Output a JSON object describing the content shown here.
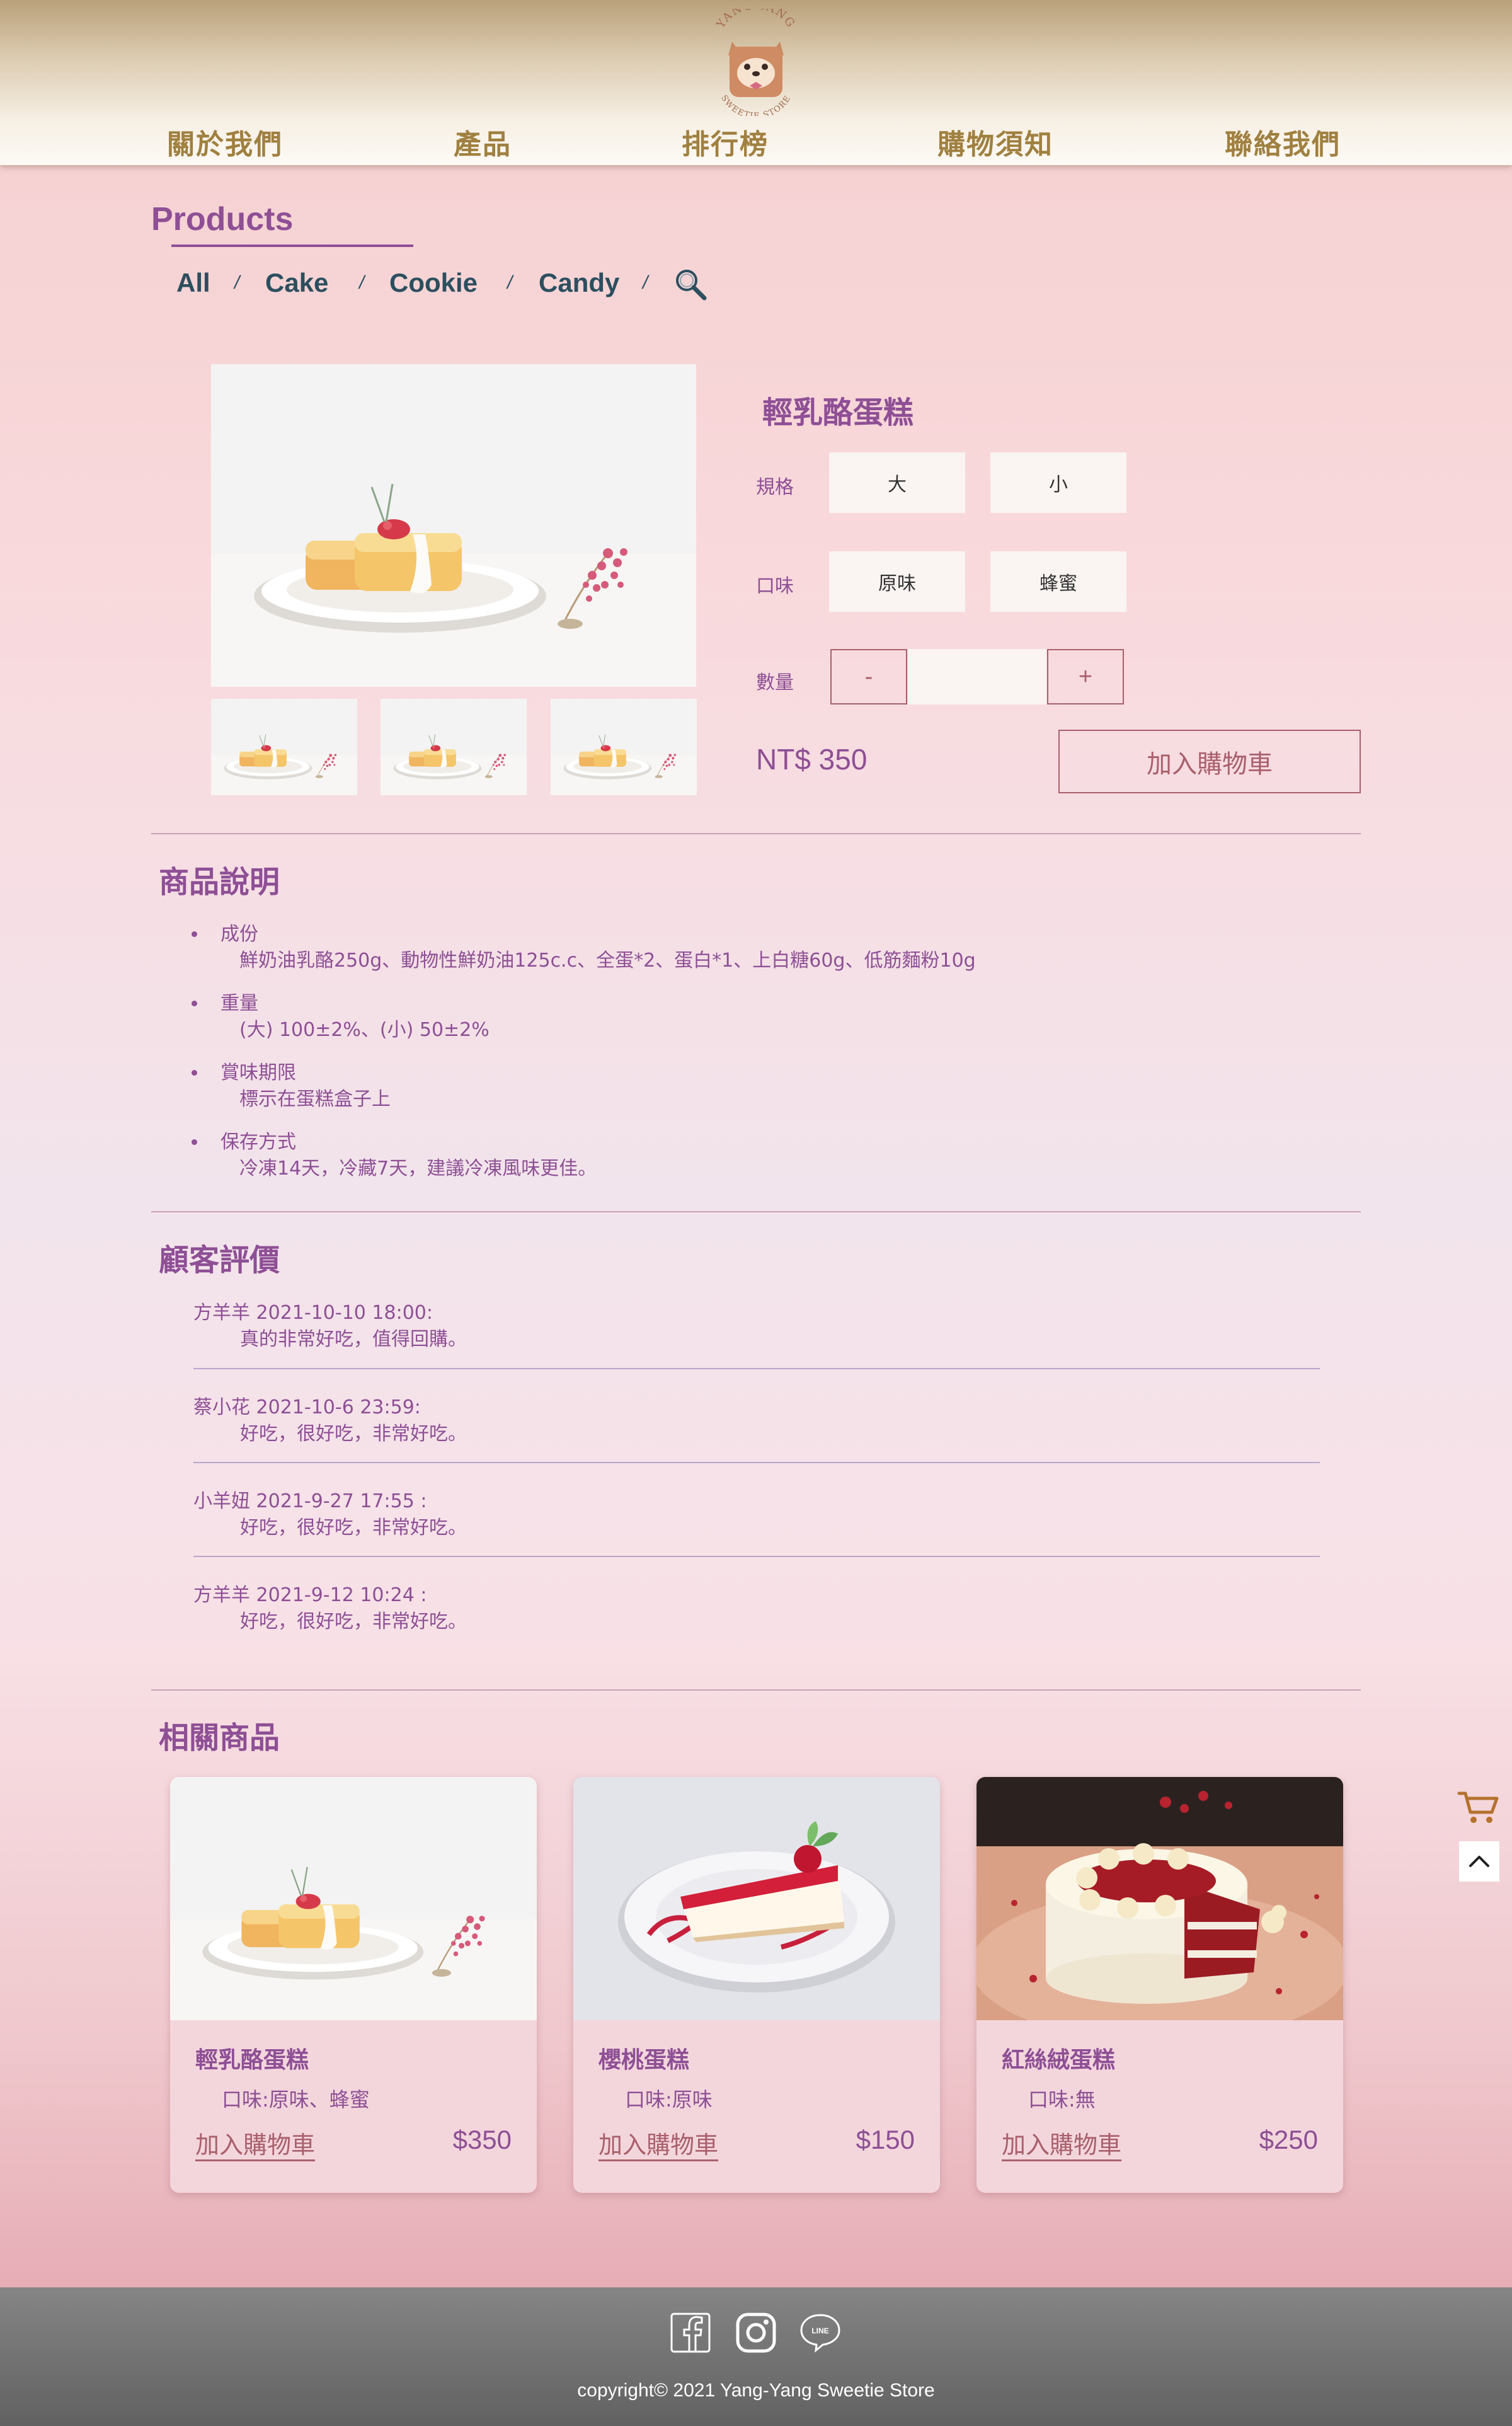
{
  "brand": {
    "logo_top": "YANG-YANG",
    "logo_bottom": "SWEETIE STORE"
  },
  "nav": [
    "關於我們",
    "產品",
    "排行榜",
    "購物須知",
    "聯絡我們"
  ],
  "products_heading": "Products",
  "categories": [
    "All",
    "Cake",
    "Cookie",
    "Candy"
  ],
  "category_separator": "/",
  "product": {
    "name": "輕乳酪蛋糕",
    "spec_label": "規格",
    "spec_options": [
      "大",
      "小"
    ],
    "flavor_label": "口味",
    "flavor_options": [
      "原味",
      "蜂蜜"
    ],
    "qty_label": "數量",
    "qty_minus": "-",
    "qty_plus": "+",
    "qty_value": "",
    "price": "NT$ 350",
    "add_to_cart": "加入購物車"
  },
  "description": {
    "title": "商品說明",
    "items": [
      {
        "key": "成份",
        "value": "鮮奶油乳酪250g、動物性鮮奶油125c.c、全蛋*2、蛋白*1、上白糖60g、低筋麵粉10g"
      },
      {
        "key": "重量",
        "value": "(大) 100±2%、(小) 50±2%"
      },
      {
        "key": "賞味期限",
        "value": "標示在蛋糕盒子上"
      },
      {
        "key": "保存方式",
        "value": "冷凍14天，冷藏7天，建議冷凍風味更佳。"
      }
    ]
  },
  "reviews": {
    "title": "顧客評價",
    "items": [
      {
        "meta": "方羊羊 2021-10-10 18:00:",
        "text": "真的非常好吃，值得回購。"
      },
      {
        "meta": "蔡小花 2021-10-6 23:59:",
        "text": "好吃，很好吃，非常好吃。"
      },
      {
        "meta": "小羊妞 2021-9-27 17:55 :",
        "text": "好吃，很好吃，非常好吃。"
      },
      {
        "meta": "方羊羊 2021-9-12 10:24 :",
        "text": "好吃，很好吃，非常好吃。"
      }
    ]
  },
  "related": {
    "title": "相關商品",
    "items": [
      {
        "name": "輕乳酪蛋糕",
        "flavor": "口味:原味、蜂蜜",
        "add": "加入購物車",
        "price": "$350"
      },
      {
        "name": "櫻桃蛋糕",
        "flavor": "口味:原味",
        "add": "加入購物車",
        "price": "$150"
      },
      {
        "name": "紅絲絨蛋糕",
        "flavor": "口味:無",
        "add": "加入購物車",
        "price": "$250"
      }
    ]
  },
  "footer": {
    "social_icons": [
      "facebook-icon",
      "instagram-icon",
      "line-icon"
    ],
    "line_label": "LINE",
    "copyright": "copyright© 2021 Yang-Yang Sweetie Store"
  },
  "colors": {
    "accent_purple": "#8e4f95",
    "nav_gold": "#a08040",
    "button_rose": "#a9606c",
    "category_teal": "#2c4f5f"
  }
}
